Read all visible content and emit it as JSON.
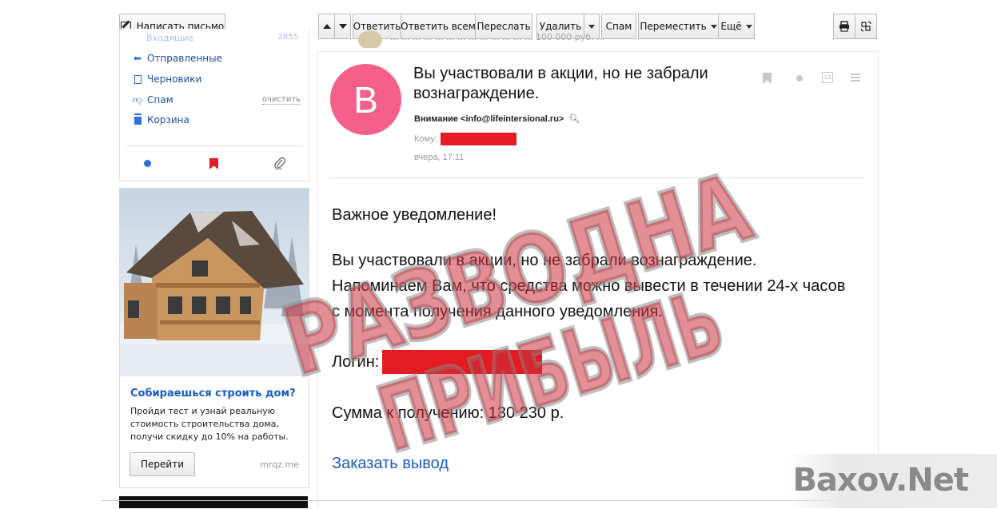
{
  "compose": {
    "label": "Написать письмо"
  },
  "sidebar": {
    "inbox": {
      "label": "Входящие",
      "count": "2855"
    },
    "items": [
      {
        "label": "Отправленные"
      },
      {
        "label": "Черновики"
      },
      {
        "label": "Спам",
        "action": "очистить"
      },
      {
        "label": "Корзина"
      }
    ]
  },
  "toolbar": {
    "reply": "Ответить",
    "reply_all": "Ответить всем",
    "forward": "Переслать",
    "delete": "Удалить",
    "spam": "Спам",
    "move": "Переместить",
    "more": "Ещё"
  },
  "topbar_snippet": "... ... ... ... ... ... ... ... ... ... ... ... ... 100 000 руб. ...",
  "message": {
    "avatar_letter": "В",
    "subject": "Вы участвовали в акции, но не забрали вознаграждение.",
    "from": "Внимание <info@lifeintersional.ru>",
    "to_label": "Кому:",
    "date": "вчера, 17:11",
    "greeting": "Важное уведомление!",
    "body": "Вы участвовали в акции, но не забрали вознаграждение. Напоминаем Вам, что средства можно вывести в течении 24-х часов с момента получения данного уведомления.",
    "login_label": "Логин:",
    "sum": "Сумма к получению: 130 230 р.",
    "link": "Заказать вывод"
  },
  "ad": {
    "title": "Собираешься строить дом?",
    "text": "Пройди тест и узнай реальную стоимость строительства дома, получи скидку до 10% на работы.",
    "button": "Перейти",
    "source": "mrqz.me"
  },
  "stamp": {
    "line1": "РАЗВОДНА",
    "line2": "ПРИБЫЛЬ"
  },
  "watermark": {
    "text": "Baxov.Net"
  },
  "colors": {
    "avatar": "#f5608a",
    "redact": "#e31b23",
    "link": "#1a5bc4",
    "stamp": "#c8323c"
  }
}
